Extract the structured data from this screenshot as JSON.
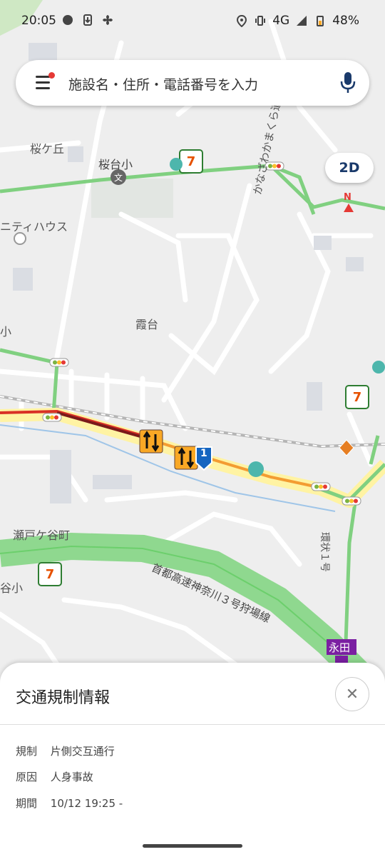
{
  "status_bar": {
    "time": "20:05",
    "network": "4G",
    "battery": "48%"
  },
  "search": {
    "placeholder": "施設名・住所・電話番号を入力"
  },
  "map": {
    "view_mode_button": "2D",
    "compass_label": "N",
    "labels": {
      "sakuragaoka": "桜ケ丘",
      "sakuradai_sho": "桜台小",
      "nity_house": "ニティハウス",
      "kanazawa_kamakura": "かなざわかまくら道",
      "kasumidai": "霞台",
      "sho_left": "小",
      "setogaya": "瀬戸ケ谷町",
      "tani_sho": "谷小",
      "expressway": "首都高速神奈川３号狩場線",
      "kanjo1": "環状１号",
      "nagata": "永田",
      "route_shield": "1"
    }
  },
  "sheet": {
    "title": "交通規制情報",
    "rows": [
      {
        "key": "規制",
        "value": "片側交互通行"
      },
      {
        "key": "原因",
        "value": "人身事故"
      },
      {
        "key": "期間",
        "value": "10/12 19:25 -"
      }
    ]
  },
  "colors": {
    "green_road": "#7fd07f",
    "yellow_road": "#fff176",
    "orange_road": "#f39c32",
    "red_road": "#d93025",
    "map_bg": "#efefef"
  }
}
